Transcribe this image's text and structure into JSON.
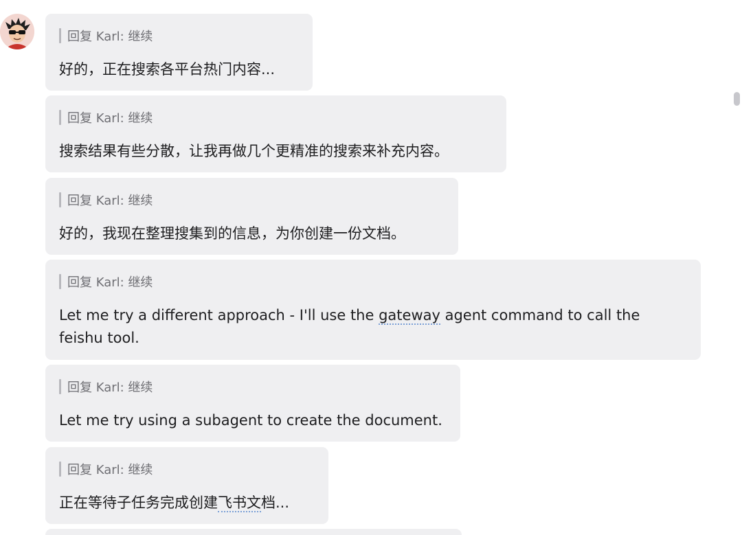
{
  "messages": [
    {
      "reply": "回复 Karl: 继续",
      "text": "好的，正在搜索各平台热门内容..."
    },
    {
      "reply": "回复 Karl: 继续",
      "text": "搜索结果有些分散，让我再做几个更精准的搜索来补充内容。"
    },
    {
      "reply": "回复 Karl: 继续",
      "text": "好的，我现在整理搜集到的信息，为你创建一份文档。"
    },
    {
      "reply": "回复 Karl: 继续",
      "text_before": "Let me try a different approach - I'll use the ",
      "text_link": "gateway",
      "text_after": " agent command to call the feishu tool."
    },
    {
      "reply": "回复 Karl: 继续",
      "text": "Let me try using a subagent to create the document."
    },
    {
      "reply": "回复 Karl: 继续",
      "text_before": "正在等待子任务完成创建",
      "text_link": "飞书文",
      "text_after": "档..."
    }
  ],
  "colors": {
    "bubble_bg": "#efeff1",
    "reply_text": "#6e6e73",
    "message_text": "#1d1d1f"
  }
}
